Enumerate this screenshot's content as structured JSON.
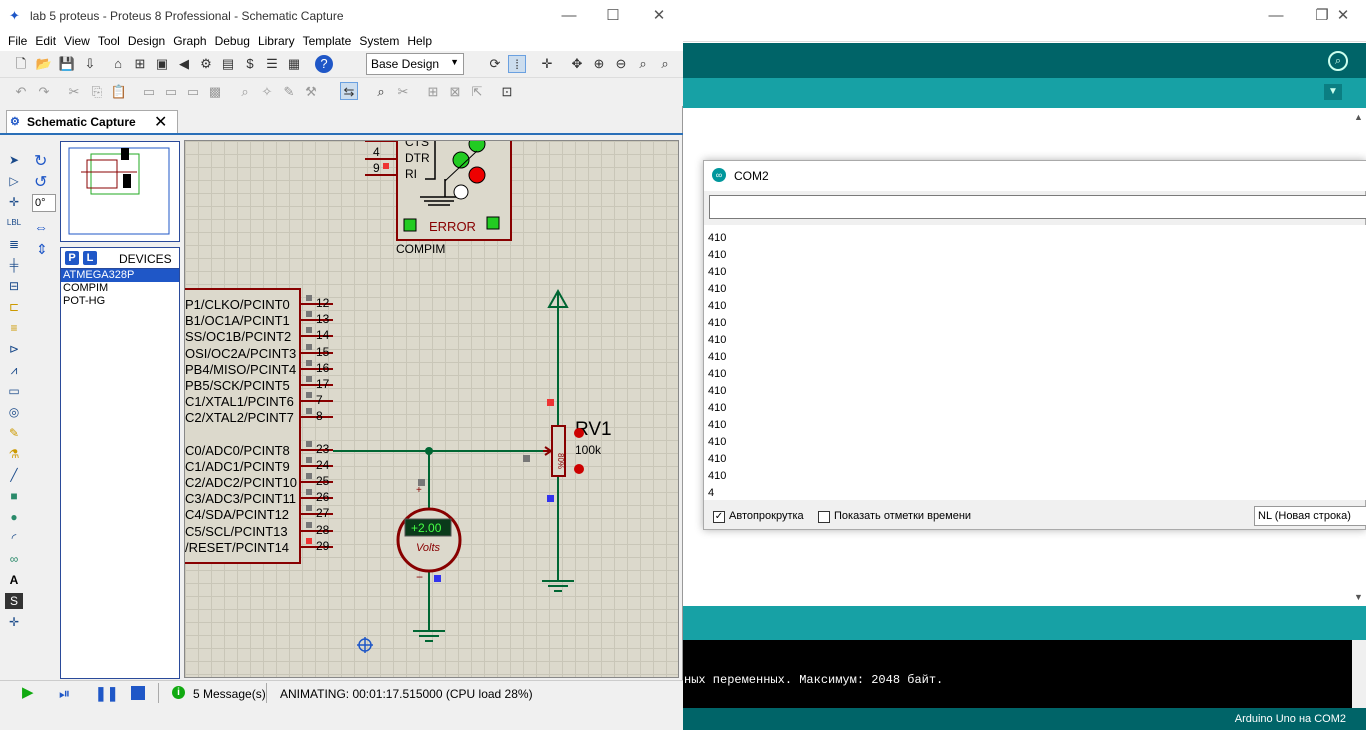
{
  "arduino": {
    "console_text": "ных переменных. Максимум: 2048 байт.",
    "status": "Arduino Uno на COM2"
  },
  "com": {
    "title": "COM2",
    "output": [
      "410",
      "410",
      "410",
      "410",
      "410",
      "410",
      "410",
      "410",
      "410",
      "410",
      "410",
      "410",
      "410",
      "410",
      "410",
      "4"
    ],
    "autoscroll_label": "Автопрокрутка",
    "autoscroll_checked": true,
    "timestamps_label": "Показать отметки времени",
    "timestamps_checked": false,
    "line_ending": "NL (Новая строка)"
  },
  "proteus": {
    "title": "lab 5 proteus - Proteus 8 Professional - Schematic Capture",
    "menu": [
      "File",
      "Edit",
      "View",
      "Tool",
      "Design",
      "Graph",
      "Debug",
      "Library",
      "Template",
      "System",
      "Help"
    ],
    "design_select": "Base Design",
    "tab_label": "Schematic Capture",
    "rotation": "0°",
    "devices_title": "DEVICES",
    "devices": [
      "ATMEGA328P",
      "COMPIM",
      "POT-HG"
    ],
    "selected_device": "ATMEGA328P",
    "messages": "5 Message(s)",
    "animating": "ANIMATING: 00:01:17.515000 (CPU load 28%)"
  },
  "schematic": {
    "compim_pins": [
      "CTS",
      "DTR",
      "RI"
    ],
    "compim_pin_numbers": [
      "4",
      "9"
    ],
    "compim_error": "ERROR",
    "compim_label": "COMPIM",
    "mcu_pins": [
      "P1/CLKO/PCINT0",
      "B1/OC1A/PCINT1",
      "SS/OC1B/PCINT2",
      "OSI/OC2A/PCINT3",
      "PB4/MISO/PCINT4",
      "PB5/SCK/PCINT5",
      "C1/XTAL1/PCINT6",
      "C2/XTAL2/PCINT7",
      "C0/ADC0/PCINT8",
      "C1/ADC1/PCINT9",
      "C2/ADC2/PCINT10",
      "C3/ADC3/PCINT11",
      "C4/SDA/PCINT12",
      "C5/SCL/PCINT13",
      "/RESET/PCINT14"
    ],
    "mcu_pin_numbers": [
      "12",
      "13",
      "14",
      "15",
      "16",
      "17",
      "7",
      "8",
      "23",
      "24",
      "25",
      "26",
      "27",
      "28",
      "29"
    ],
    "voltmeter_value": "+2.00",
    "voltmeter_unit": "Volts",
    "pot_name": "RV1",
    "pot_value": "100k",
    "pot_percent": "80%"
  }
}
